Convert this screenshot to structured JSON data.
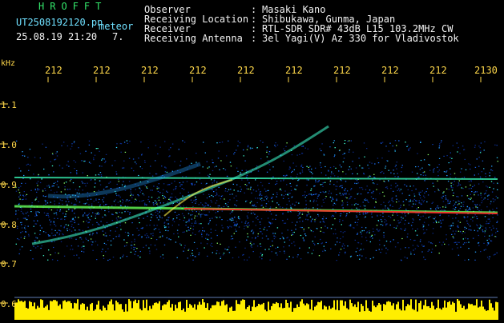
{
  "header": {
    "brand": "HROFFT",
    "filename": "UT2508192120.pn",
    "type_label": "meteor",
    "datetime": "25.08.19 21:20",
    "count": "7.",
    "info": [
      {
        "label": "Observer",
        "sep": ":",
        "value": "Masaki Kano"
      },
      {
        "label": "Receiving Location",
        "sep": ":",
        "value": "Shibukawa, Gunma, Japan"
      },
      {
        "label": "Receiver",
        "sep": ":",
        "value": "RTL-SDR SDR# 43dB L15 103.2MHz CW"
      },
      {
        "label": "Receiving Antenna",
        "sep": ":",
        "value": "3el Yagi(V) Az 330 for Vladivostok"
      }
    ]
  },
  "axis": {
    "unit": "kHz",
    "time_ticks": [
      "212",
      "212",
      "212",
      "212",
      "212",
      "212",
      "212",
      "212",
      "212",
      "2130"
    ],
    "freq_ticks": [
      "1.1",
      "1.0",
      "0.9",
      "0.8",
      "0.7",
      "0.6"
    ]
  },
  "colors": {
    "background": "#000000",
    "text": "#f2f2f2",
    "cyan": "#6fe0ff",
    "brand": "#33e66b",
    "ticks": "#ffd84a",
    "noise_strip": "#ffee00",
    "tone": "#ff2a2a"
  }
}
